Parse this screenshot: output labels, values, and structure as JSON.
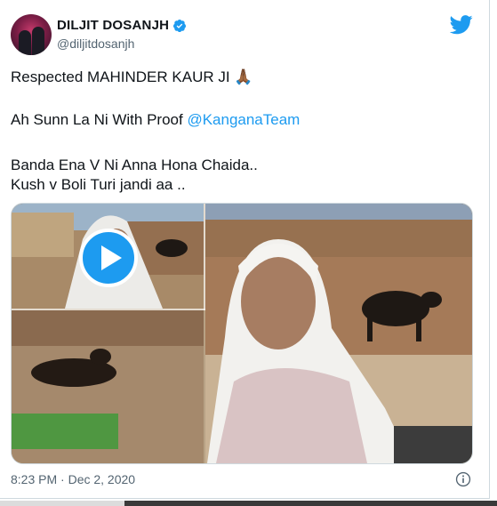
{
  "tweet": {
    "author_name": "DILJIT DOSANJH",
    "author_handle": "@diljitdosanjh",
    "line1_text": "Respected MAHINDER KAUR JI",
    "line1_emoji": "🙏🏾",
    "line2_text": "Ah Sunn La Ni With Proof ",
    "line2_mention": "@KanganaTeam",
    "line3": "Banda Ena V Ni Anna Hona Chaida..",
    "line4": "Kush v Boli Turi jandi aa ..",
    "timestamp": "8:23 PM · Dec 2, 2020"
  },
  "colors": {
    "accent": "#1d9bf0",
    "text": "#0f1419",
    "muted": "#536471"
  },
  "icons": {
    "verified": "verified-badge-icon",
    "brand": "twitter-bird-icon",
    "play": "play-icon",
    "info": "info-icon"
  }
}
